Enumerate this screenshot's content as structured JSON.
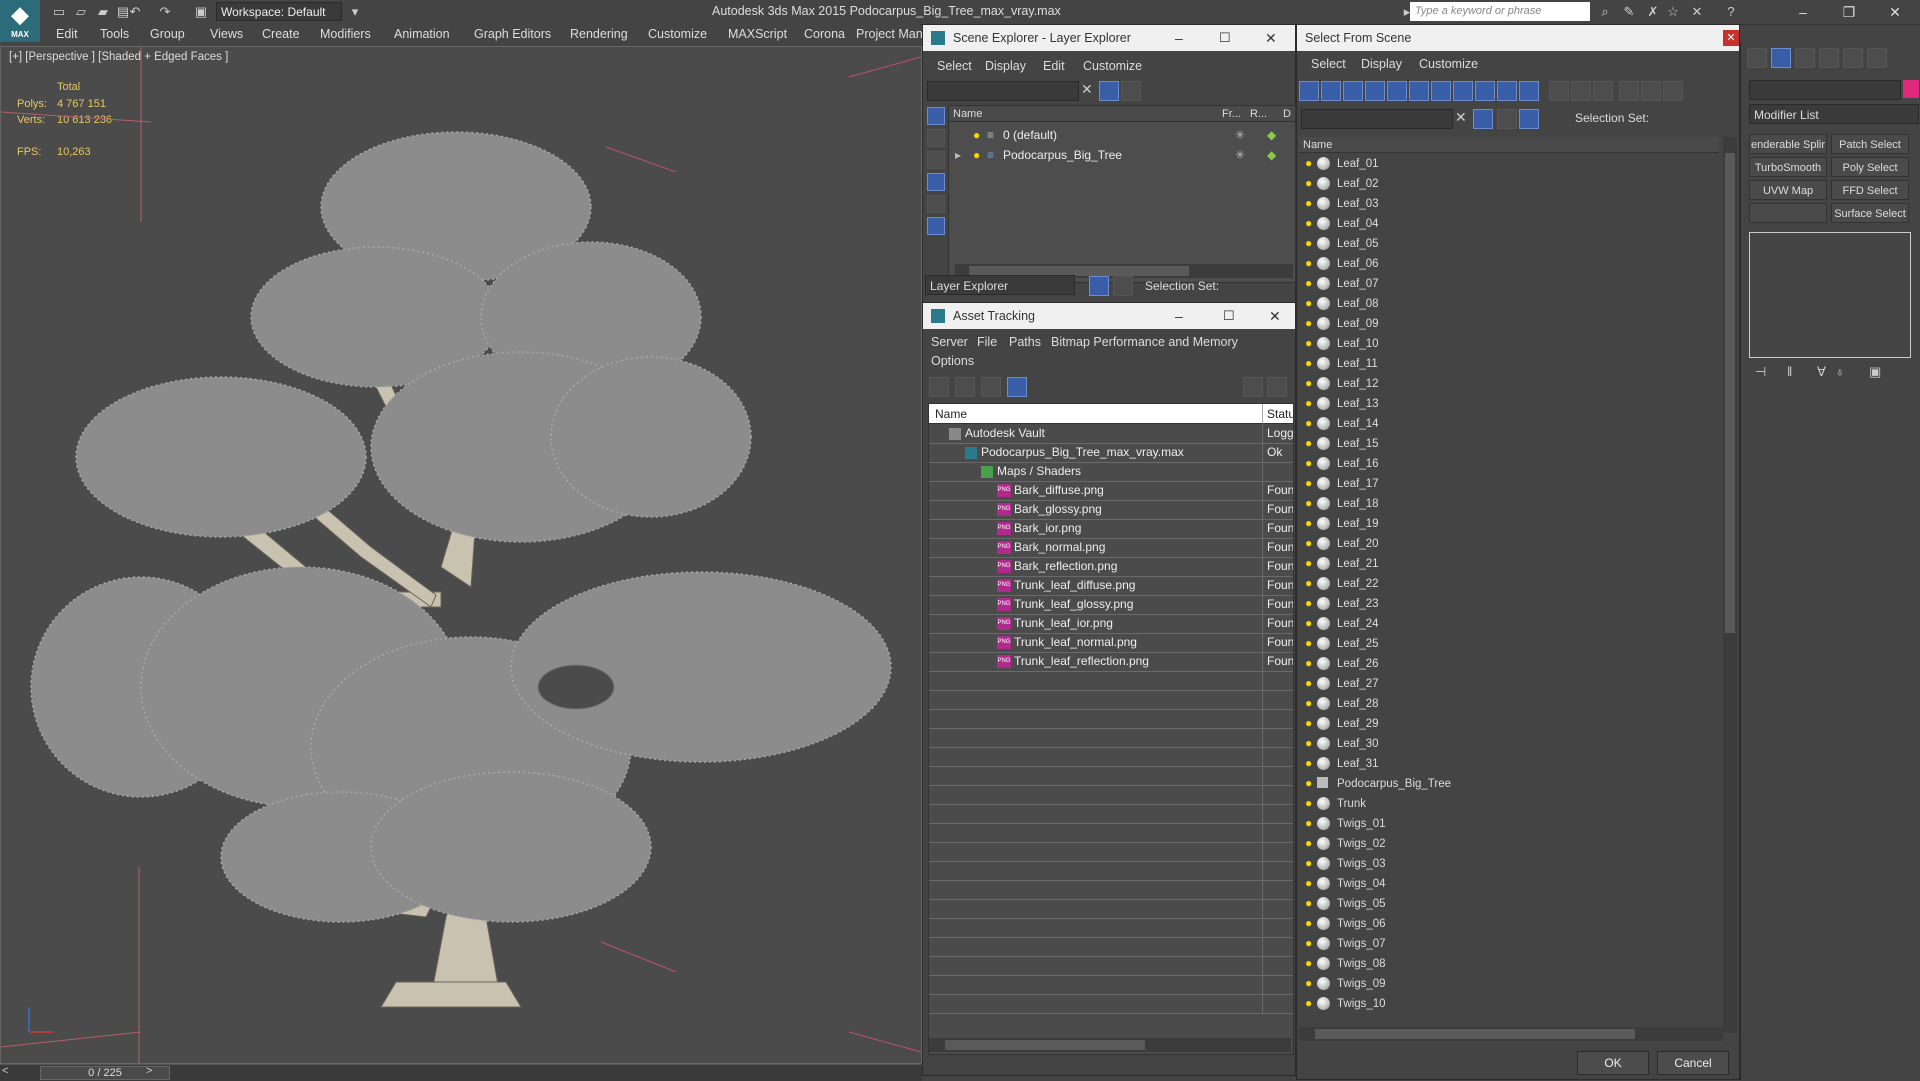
{
  "app": {
    "logo": "MAX",
    "workspace": "Workspace: Default",
    "title": "Autodesk 3ds Max  2015      Podocarpus_Big_Tree_max_vray.max",
    "search_placeholder": "Type a keyword or phrase"
  },
  "menu": [
    "Edit",
    "Tools",
    "Group",
    "Views",
    "Create",
    "Modifiers",
    "Animation",
    "Graph Editors",
    "Rendering",
    "Customize",
    "MAXScript",
    "Corona",
    "Project Man"
  ],
  "viewport": {
    "label": "[+] [Perspective ] [Shaded + Edged Faces ]",
    "total_label": "Total",
    "polys_label": "Polys:",
    "polys_value": "4 767 151",
    "verts_label": "Verts:",
    "verts_value": "10 613 236",
    "fps_label": "FPS:",
    "fps_value": "10,263"
  },
  "timeline": {
    "frame": "0 / 225"
  },
  "scene_explorer": {
    "title": "Scene Explorer - Layer Explorer",
    "menu": [
      "Select",
      "Display",
      "Edit",
      "Customize"
    ],
    "columns": [
      "Name",
      "Fr...",
      "R...",
      "D"
    ],
    "rows": [
      "0 (default)",
      "Podocarpus_Big_Tree"
    ],
    "explorer_select": "Layer Explorer",
    "selection_set_label": "Selection Set:"
  },
  "asset_tracking": {
    "title": "Asset Tracking",
    "menu": [
      "Server",
      "File",
      "Paths",
      "Bitmap Performance and Memory"
    ],
    "menu2": "Options",
    "columns": [
      "Name",
      "Status"
    ],
    "rows": [
      {
        "name": "Autodesk Vault",
        "status": "Logged"
      },
      {
        "name": "Podocarpus_Big_Tree_max_vray.max",
        "status": "Ok"
      },
      {
        "name": "Maps / Shaders",
        "status": ""
      },
      {
        "name": "Bark_diffuse.png",
        "status": "Found"
      },
      {
        "name": "Bark_glossy.png",
        "status": "Found"
      },
      {
        "name": "Bark_ior.png",
        "status": "Found"
      },
      {
        "name": "Bark_normal.png",
        "status": "Found"
      },
      {
        "name": "Bark_reflection.png",
        "status": "Found"
      },
      {
        "name": "Trunk_leaf_diffuse.png",
        "status": "Found"
      },
      {
        "name": "Trunk_leaf_glossy.png",
        "status": "Found"
      },
      {
        "name": "Trunk_leaf_ior.png",
        "status": "Found"
      },
      {
        "name": "Trunk_leaf_normal.png",
        "status": "Found"
      },
      {
        "name": "Trunk_leaf_reflection.png",
        "status": "Found"
      }
    ],
    "png_icon": "PNG"
  },
  "select_from_scene": {
    "title": "Select From Scene",
    "menu": [
      "Select",
      "Display",
      "Customize"
    ],
    "selection_set_label": "Selection Set:",
    "column": "Name",
    "items": [
      "Leaf_01",
      "Leaf_02",
      "Leaf_03",
      "Leaf_04",
      "Leaf_05",
      "Leaf_06",
      "Leaf_07",
      "Leaf_08",
      "Leaf_09",
      "Leaf_10",
      "Leaf_11",
      "Leaf_12",
      "Leaf_13",
      "Leaf_14",
      "Leaf_15",
      "Leaf_16",
      "Leaf_17",
      "Leaf_18",
      "Leaf_19",
      "Leaf_20",
      "Leaf_21",
      "Leaf_22",
      "Leaf_23",
      "Leaf_24",
      "Leaf_25",
      "Leaf_26",
      "Leaf_27",
      "Leaf_28",
      "Leaf_29",
      "Leaf_30",
      "Leaf_31",
      "Podocarpus_Big_Tree",
      "Trunk",
      "Twigs_01",
      "Twigs_02",
      "Twigs_03",
      "Twigs_04",
      "Twigs_05",
      "Twigs_06",
      "Twigs_07",
      "Twigs_08",
      "Twigs_09",
      "Twigs_10"
    ],
    "ok": "OK",
    "cancel": "Cancel"
  },
  "command_panel": {
    "modifier_list": "Modifier List",
    "buttons": [
      "enderable Splir",
      "Patch Select",
      "TurboSmooth",
      "Poly Select",
      "UVW Map",
      "FFD Select",
      "",
      "Surface Select"
    ]
  },
  "colors": {
    "accent_blue": "#3a5da8",
    "stats_yellow": "#e8c860",
    "viewport_bg": "#4b4b4b",
    "tree_grey": "#8c8c8c"
  }
}
